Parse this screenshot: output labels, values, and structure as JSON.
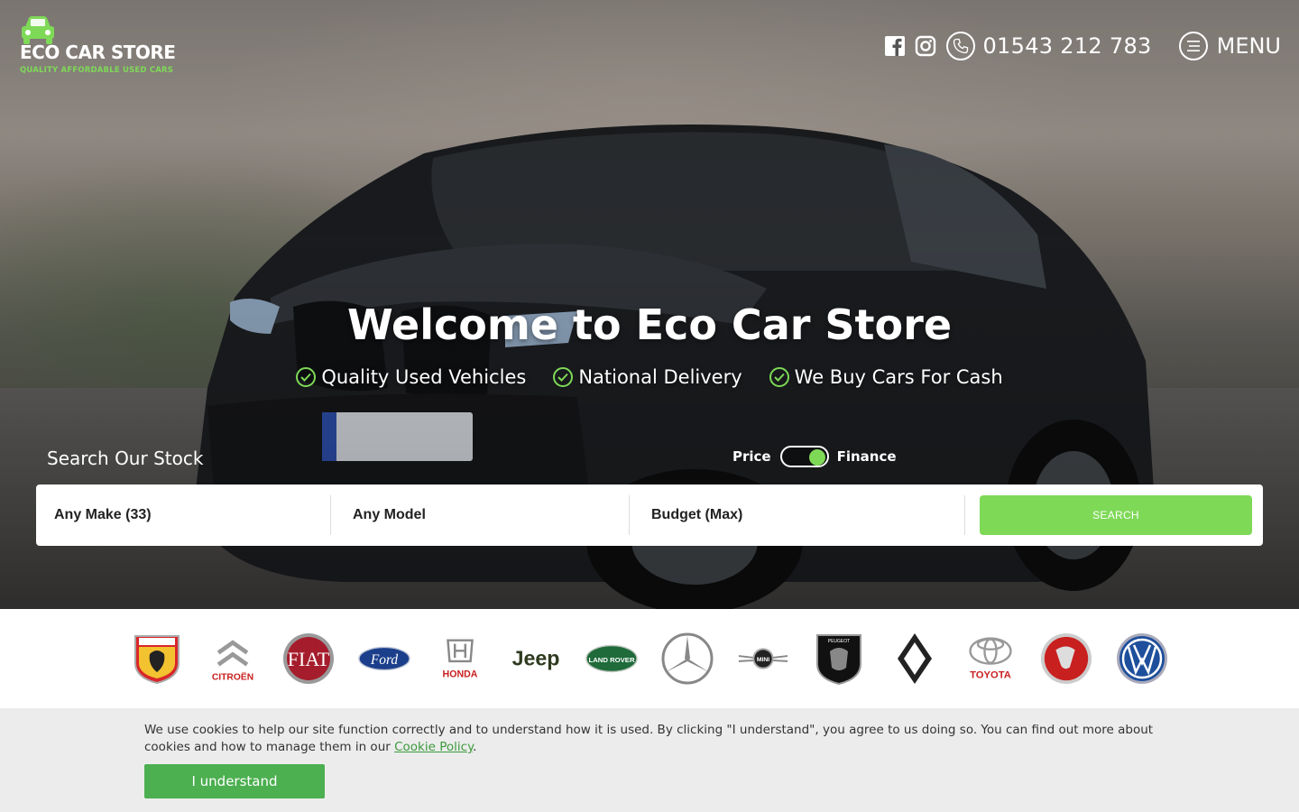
{
  "header": {
    "logo_title": "ECO CAR STORE",
    "logo_subtitle": "QUALITY AFFORDABLE USED CARS",
    "phone": "01543 212 783",
    "menu_label": "MENU"
  },
  "hero": {
    "headline": "Welcome to Eco Car Store",
    "features": [
      "Quality Used Vehicles",
      "National Delivery",
      "We Buy Cars For Cash"
    ]
  },
  "search": {
    "title": "Search Our Stock",
    "toggle_left": "Price",
    "toggle_right": "Finance",
    "toggle_state": "Finance",
    "make": "Any Make (33)",
    "model": "Any Model",
    "budget": "Budget (Max)",
    "button": "SEARCH"
  },
  "brands": [
    {
      "name": "Abarth",
      "icon": "abarth-logo-icon"
    },
    {
      "name": "Citroën",
      "label": "CITROËN",
      "icon": "citroen-logo-icon"
    },
    {
      "name": "Fiat",
      "label": "FIAT",
      "icon": "fiat-logo-icon"
    },
    {
      "name": "Ford",
      "label": "Ford",
      "icon": "ford-logo-icon"
    },
    {
      "name": "Honda",
      "label": "HONDA",
      "icon": "honda-logo-icon"
    },
    {
      "name": "Jeep",
      "label": "Jeep",
      "icon": "jeep-logo-icon"
    },
    {
      "name": "Land Rover",
      "label": "LAND ROVER",
      "icon": "land-rover-logo-icon"
    },
    {
      "name": "Mercedes-Benz",
      "icon": "mercedes-logo-icon"
    },
    {
      "name": "Mini",
      "label": "MINI",
      "icon": "mini-logo-icon"
    },
    {
      "name": "Peugeot",
      "label": "PEUGEOT",
      "icon": "peugeot-logo-icon"
    },
    {
      "name": "Renault",
      "icon": "renault-logo-icon"
    },
    {
      "name": "Toyota",
      "label": "TOYOTA",
      "icon": "toyota-logo-icon"
    },
    {
      "name": "Vauxhall",
      "icon": "vauxhall-logo-icon"
    },
    {
      "name": "Volkswagen",
      "icon": "volkswagen-logo-icon"
    }
  ],
  "cookie": {
    "text": "We use cookies to help our site function correctly and to understand how it is used. By clicking \"I understand\", you agree to us doing so. You can find out more about cookies and how to manage them in our",
    "link": "Cookie Policy",
    "after_link": ".",
    "button": "I understand"
  },
  "colors": {
    "accent": "#7ed957",
    "cookie_button": "#4caf50",
    "cookie_bg": "#ececec"
  }
}
